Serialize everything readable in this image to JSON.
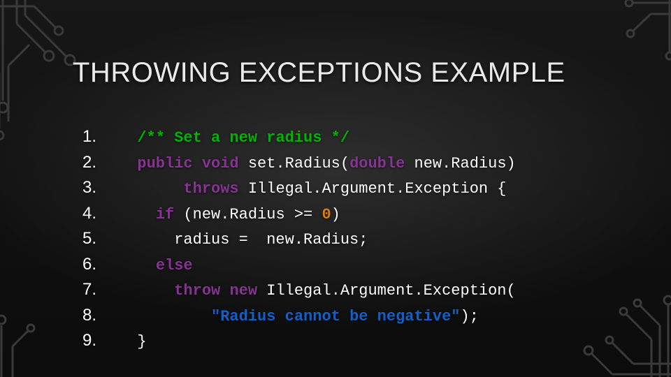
{
  "title": "THROWING EXCEPTIONS EXAMPLE",
  "code": {
    "lines": [
      {
        "n": "1.",
        "tokens": [
          {
            "cls": "tok-id",
            "t": "  "
          },
          {
            "cls": "tok-comm",
            "t": "/** Set a new radius */"
          }
        ]
      },
      {
        "n": "2.",
        "tokens": [
          {
            "cls": "tok-id",
            "t": "  "
          },
          {
            "cls": "tok-kw",
            "t": "public"
          },
          {
            "cls": "tok-id",
            "t": " "
          },
          {
            "cls": "tok-kw",
            "t": "void"
          },
          {
            "cls": "tok-id",
            "t": " set.Radius("
          },
          {
            "cls": "tok-kw",
            "t": "double"
          },
          {
            "cls": "tok-id",
            "t": " new.Radius)"
          }
        ]
      },
      {
        "n": "3.",
        "tokens": [
          {
            "cls": "tok-id",
            "t": "       "
          },
          {
            "cls": "tok-kw",
            "t": "throws"
          },
          {
            "cls": "tok-id",
            "t": " Illegal.Argument.Exception {"
          }
        ]
      },
      {
        "n": "4.",
        "tokens": [
          {
            "cls": "tok-id",
            "t": "    "
          },
          {
            "cls": "tok-kw",
            "t": "if"
          },
          {
            "cls": "tok-id",
            "t": " (new.Radius >= "
          },
          {
            "cls": "tok-num",
            "t": "0"
          },
          {
            "cls": "tok-id",
            "t": ")"
          }
        ]
      },
      {
        "n": "5.",
        "tokens": [
          {
            "cls": "tok-id",
            "t": "      radius =  new.Radius;"
          }
        ]
      },
      {
        "n": "6.",
        "tokens": [
          {
            "cls": "tok-id",
            "t": "    "
          },
          {
            "cls": "tok-kw",
            "t": "else"
          }
        ]
      },
      {
        "n": "7.",
        "tokens": [
          {
            "cls": "tok-id",
            "t": "      "
          },
          {
            "cls": "tok-kw",
            "t": "throw"
          },
          {
            "cls": "tok-id",
            "t": " "
          },
          {
            "cls": "tok-kw",
            "t": "new"
          },
          {
            "cls": "tok-id",
            "t": " Illegal.Argument.Exception("
          }
        ]
      },
      {
        "n": "8.",
        "tokens": [
          {
            "cls": "tok-id",
            "t": "          "
          },
          {
            "cls": "tok-str",
            "t": "\"Radius cannot be negative\""
          },
          {
            "cls": "tok-id",
            "t": ");"
          }
        ]
      },
      {
        "n": "9.",
        "tokens": [
          {
            "cls": "tok-id",
            "t": "  }"
          }
        ]
      }
    ]
  },
  "decor": {
    "stroke": "#2e2e2e",
    "fill": "#2e2e2e"
  }
}
